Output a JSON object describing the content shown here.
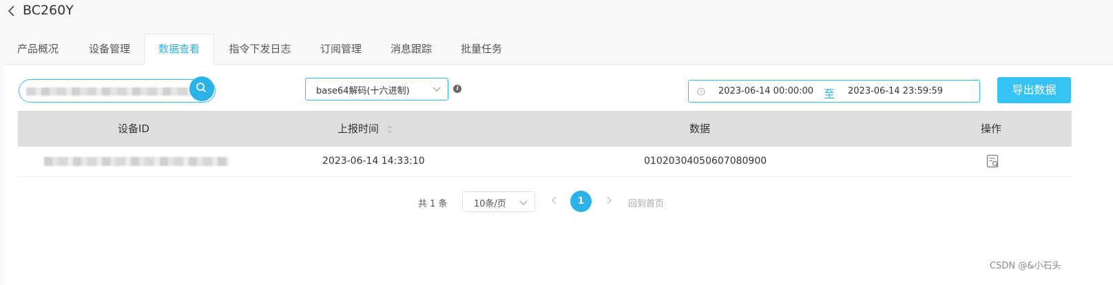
{
  "header": {
    "title": "BC260Y"
  },
  "tabs": [
    {
      "label": "产品概况"
    },
    {
      "label": "设备管理"
    },
    {
      "label": "数据查看",
      "active": true
    },
    {
      "label": "指令下发日志"
    },
    {
      "label": "订阅管理"
    },
    {
      "label": "消息跟踪"
    },
    {
      "label": "批量任务"
    }
  ],
  "filters": {
    "search": {
      "value": "████████████████████"
    },
    "decode": {
      "selected": "base64解码(十六进制)"
    },
    "date_range": {
      "start": "2023-06-14 00:00:00",
      "separator": "至",
      "end": "2023-06-14 23:59:59"
    },
    "export_label": "导出数据"
  },
  "table": {
    "columns": [
      "设备ID",
      "上报时间",
      "数据",
      "操作"
    ],
    "rows": [
      {
        "device_id": "████████████████████████",
        "time": "2023-06-14 14:33:10",
        "data": "01020304050607080900"
      }
    ]
  },
  "pagination": {
    "total": "共 1 条",
    "page_size": "10条/页",
    "current_page": "1",
    "first_page": "回到首页"
  },
  "watermark": "CSDN @&小石头",
  "colors": {
    "accent": "#2bb2e6",
    "header_bg": "#dedede"
  },
  "icons": [
    "back-icon",
    "search-icon",
    "chevron-down-icon",
    "info-icon",
    "clock-icon",
    "sort-icon",
    "view-detail-icon",
    "chevron-left-icon",
    "chevron-right-icon"
  ]
}
